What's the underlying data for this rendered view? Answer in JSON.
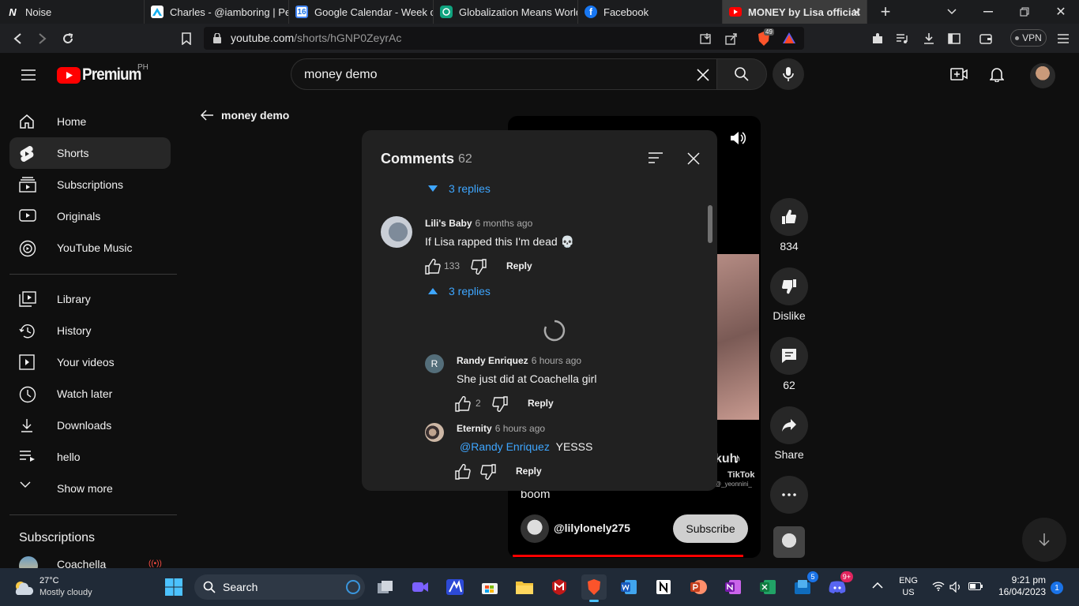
{
  "browser": {
    "tabs": [
      {
        "title": "Noise",
        "icon": "noise-favicon"
      },
      {
        "title": "Charles - @iamboring | Pea",
        "icon": "artstation-favicon"
      },
      {
        "title": "Google Calendar - Week of",
        "icon": "calendar-favicon",
        "icon_text": "16"
      },
      {
        "title": "Globalization Means World",
        "icon": "openai-favicon"
      },
      {
        "title": "Facebook",
        "icon": "facebook-favicon"
      },
      {
        "title": "MONEY by Lisa official",
        "icon": "youtube-favicon",
        "active": true
      }
    ],
    "url_host": "youtube.com",
    "url_path": "/shorts/hGNP0ZeyrAc",
    "brave_shield_count": "49",
    "vpn_label": "VPN"
  },
  "youtube": {
    "logo_text": "Premium",
    "region": "PH",
    "search_value": "money demo",
    "back_label": "money demo"
  },
  "sidebar": {
    "items": [
      {
        "label": "Home",
        "icon": "home-icon"
      },
      {
        "label": "Shorts",
        "icon": "shorts-icon",
        "active": true
      },
      {
        "label": "Subscriptions",
        "icon": "subscriptions-icon"
      },
      {
        "label": "Originals",
        "icon": "originals-icon"
      },
      {
        "label": "YouTube Music",
        "icon": "youtube-music-icon"
      },
      {
        "label": "Library",
        "icon": "library-icon"
      },
      {
        "label": "History",
        "icon": "history-icon"
      },
      {
        "label": "Your videos",
        "icon": "your-videos-icon"
      },
      {
        "label": "Watch later",
        "icon": "watch-later-icon"
      },
      {
        "label": "Downloads",
        "icon": "download-icon"
      },
      {
        "label": "hello",
        "icon": "playlist-icon"
      },
      {
        "label": "Show more",
        "icon": "chevron-down-icon"
      }
    ],
    "subscriptions_heading": "Subscriptions",
    "subscription_channel": "Coachella"
  },
  "short": {
    "caption_fragment": "boom",
    "channel": "@lilylonely275",
    "subscribe_label": "Subscribe",
    "watermark_app": "TikTok",
    "watermark_user": "@_yeonnini_",
    "watermark_chars": "kuh",
    "likes": "834",
    "dislike_label": "Dislike",
    "comment_count": "62",
    "share_label": "Share"
  },
  "comments": {
    "title": "Comments",
    "count": "62",
    "threads": [
      {
        "toggle_label": "3 replies",
        "expanded": false
      }
    ],
    "comment": {
      "author": "Lili's Baby",
      "time": "6 months ago",
      "text": "If Lisa rapped this I'm dead 💀",
      "likes": "133",
      "reply_label": "Reply",
      "toggle_label": "3 replies"
    },
    "replies": [
      {
        "author": "Randy Enriquez",
        "avatar_letter": "R",
        "time": "6 hours ago",
        "text": "She just did at Coachella girl",
        "likes": "2",
        "reply_label": "Reply"
      },
      {
        "author": "Eternity",
        "time": "6 hours ago",
        "mention": "@Randy Enriquez",
        "text": "YESSS",
        "likes": "",
        "reply_label": "Reply"
      }
    ]
  },
  "taskbar": {
    "weather_temp": "27°C",
    "weather_desc": "Mostly cloudy",
    "search_label": "Search",
    "store_badge": "5",
    "discord_badge": "9+",
    "lang": "ENG",
    "region": "US",
    "time": "9:21 pm",
    "date": "16/04/2023",
    "notif_count": "1"
  },
  "colors": {
    "accent": "#3ea6ff",
    "youtube_red": "#ff0000",
    "panel": "#212121"
  }
}
